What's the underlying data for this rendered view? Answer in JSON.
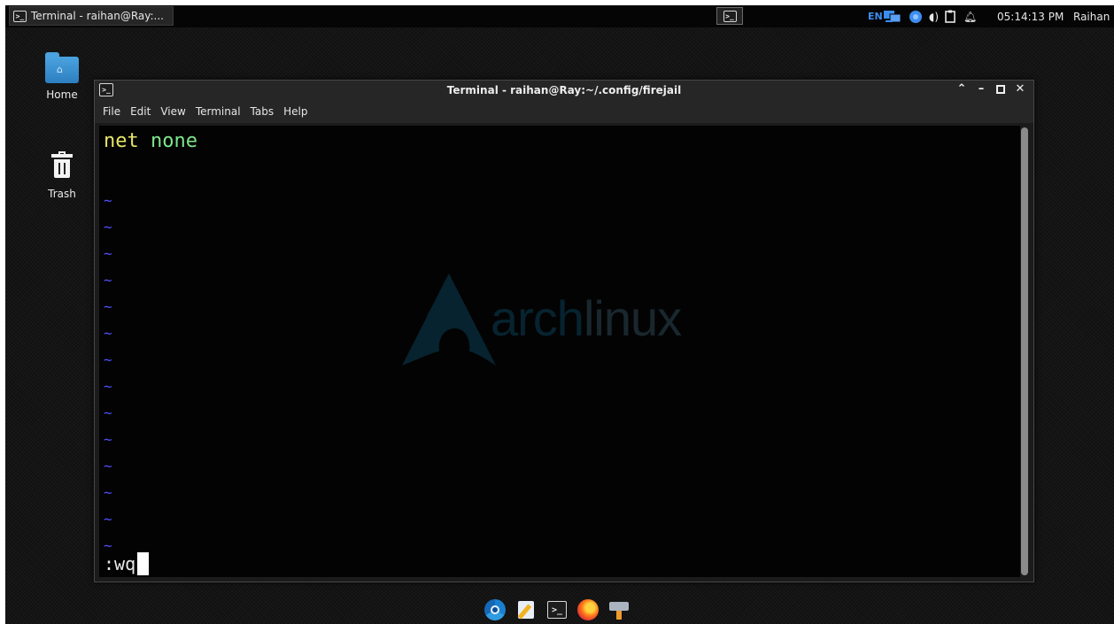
{
  "panel": {
    "task_label": "Terminal - raihan@Ray:...",
    "tray": {
      "language": "EN",
      "clock": "05:14:13 PM",
      "user": "Raihan"
    }
  },
  "desktop": {
    "icons": [
      {
        "label": "Home",
        "icon": "home-folder-icon"
      },
      {
        "label": "Trash",
        "icon": "trash-icon"
      }
    ]
  },
  "window": {
    "title": "Terminal - raihan@Ray:~/.config/firejail",
    "controls": [
      "up-arrow",
      "minimize",
      "maximize",
      "close"
    ],
    "menu": [
      "File",
      "Edit",
      "View",
      "Terminal",
      "Tabs",
      "Help"
    ]
  },
  "editor": {
    "line1_keyword": "net",
    "line1_value": "none",
    "tilde": "~",
    "tilde_count": 14,
    "command": ":wq"
  },
  "watermark": {
    "bold": "arch",
    "light": "linux"
  },
  "dock": [
    "browser-icon",
    "text-editor-icon",
    "terminal-icon",
    "firefox-icon",
    "disk-mount-icon"
  ],
  "colors": {
    "keyword": "#e6e667",
    "value": "#7ee58a",
    "tilde": "#5050ff",
    "accent": "#3c8df0"
  }
}
